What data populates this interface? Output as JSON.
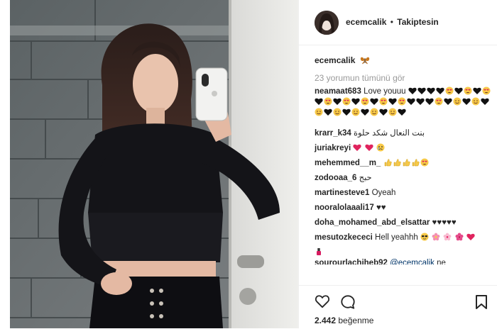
{
  "header": {
    "username": "ecemcalik",
    "separator": "•",
    "follow_status": "Takiptesin"
  },
  "caption": {
    "username": "ecemcalik",
    "emoji": "butterfly-emoji"
  },
  "view_all_comments": "23 yorumun tümünü gör",
  "comments": [
    {
      "user": "neamaat683",
      "text": "Love youuu",
      "emoji_pattern": "hearts-and-heart-eyes"
    },
    {
      "user": "krarr_k34",
      "text": "بنت النعال شكد حلوة"
    },
    {
      "user": "juriakreyi",
      "text": "",
      "emoji_pattern": "red-heart, red-heart, crying-face"
    },
    {
      "user": "mehemmed__m_",
      "text": "",
      "emoji_pattern": "thumbs-up x4, heart-eyes"
    },
    {
      "user": "zodooaa_6",
      "text": "حبج"
    },
    {
      "user": "martinesteve1",
      "text": "Oyeah"
    },
    {
      "user": "nooralolaaali17",
      "text": "♥♥"
    },
    {
      "user": "doha_mohamed_abd_elsattar",
      "text": "♥♥♥♥♥"
    },
    {
      "user": "mesutozkececi",
      "text": "Hell yeahhh",
      "emoji_pattern": "sunglasses, blossom, cherry-blossom, hibiscus, heart, nail-polish"
    },
    {
      "user": "sourourlachiheb92",
      "text": "ne",
      "mention": "@ecemcalik"
    }
  ],
  "actions": {
    "like_icon": "heart-outline-icon",
    "comment_icon": "comment-bubble-icon",
    "save_icon": "bookmark-icon"
  },
  "likes": {
    "count": "2.442",
    "label": "beğenme"
  },
  "colors": {
    "text": "#262626",
    "muted": "#999999",
    "border": "#efefef",
    "mention": "#003569"
  }
}
